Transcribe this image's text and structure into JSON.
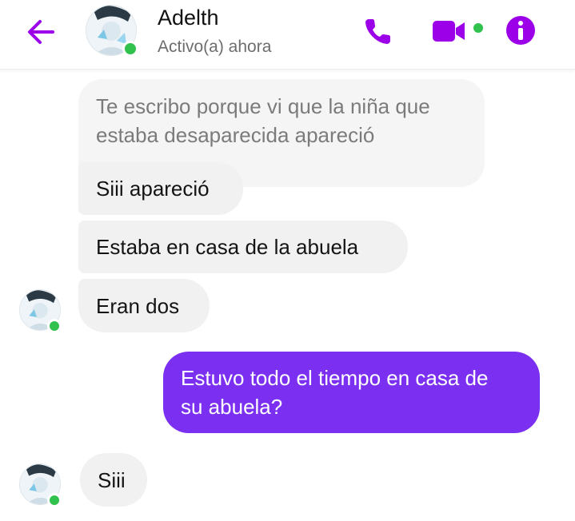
{
  "contact": {
    "name": "Adelth",
    "status": "Activo(a) ahora"
  },
  "icons": {
    "back": "arrow-left-icon",
    "call": "phone-icon",
    "video": "video-camera-icon",
    "info": "info-icon"
  },
  "colors": {
    "accent": "#9b00e8",
    "sent_bubble": "#7b2ff0",
    "online": "#31c24d"
  },
  "messages": [
    {
      "from": "contact",
      "text": "Te escribo porque vi que la niña que estaba desaparecida apareció"
    },
    {
      "from": "contact",
      "text": "Siii apareció"
    },
    {
      "from": "contact",
      "text": "Estaba en casa de la abuela"
    },
    {
      "from": "contact",
      "text": "Eran dos"
    },
    {
      "from": "me",
      "text": "Estuvo todo el tiempo en casa de su abuela?"
    },
    {
      "from": "contact",
      "text": "Siii"
    }
  ]
}
